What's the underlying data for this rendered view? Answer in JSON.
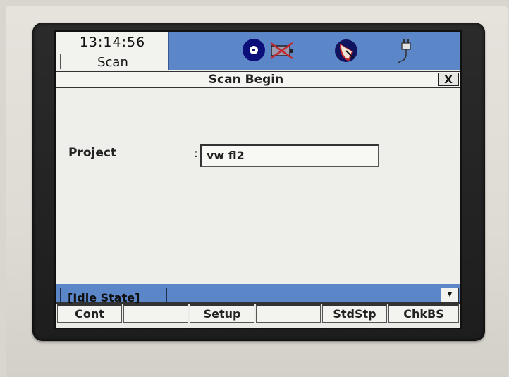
{
  "header": {
    "time": "13:14:56",
    "mode": "Scan",
    "icons": [
      "disc-icon",
      "battery-crossed-icon",
      "dish-sensor-icon",
      "power-plug-icon"
    ]
  },
  "dialog": {
    "title": "Scan Begin",
    "close_label": "X"
  },
  "form": {
    "project_label": "Project",
    "separator": ":",
    "project_value": "vw fl2"
  },
  "status": {
    "state": "[Idle State]",
    "scroll_icon": "triangle-down-icon"
  },
  "softkeys": [
    {
      "label": "Cont"
    },
    {
      "label": ""
    },
    {
      "label": "Setup"
    },
    {
      "label": ""
    },
    {
      "label": "StdStp"
    },
    {
      "label": "ChkBS"
    }
  ],
  "colors": {
    "header_blue": "#5b86c8",
    "screen_bg": "#eeeeea",
    "bezel": "#222222"
  }
}
